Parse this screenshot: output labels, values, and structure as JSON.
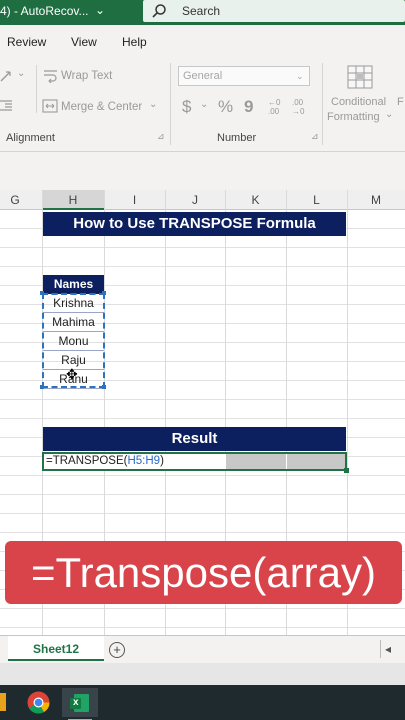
{
  "titlebar": {
    "title": "4) - AutoRecov...",
    "search_label": "Search",
    "chevron": "⌄",
    "color": "#1e6e42"
  },
  "menu": {
    "items": [
      "Review",
      "View",
      "Help"
    ]
  },
  "ribbon": {
    "wrap_text": "Wrap Text",
    "merge_center": "Merge & Center",
    "alignment_label": "Alignment",
    "number_format": "General",
    "currency_symbol": "$",
    "percent_symbol": "%",
    "comma_symbol": "9",
    "number_label": "Number",
    "conditional_formatting_line1": "Conditional",
    "conditional_formatting_line2": "Formatting",
    "cut_letter": "F",
    "dropdown_arrow": "⌄",
    "launcher_glyph": "⊿",
    "increase_decimal": "←0 .00",
    "decrease_decimal": ".00 →0"
  },
  "columns": [
    "G",
    "H",
    "I",
    "J",
    "K",
    "L",
    "M"
  ],
  "sheet": {
    "title": "How to Use TRANSPOSE Formula",
    "names_header": "Names",
    "names": [
      "Krishna",
      "Mahima",
      "Monu",
      "Raju",
      "Ranu"
    ],
    "result_header": "Result",
    "formula_prefix": "=TRANSPOSE(",
    "formula_range": "H5:H9",
    "formula_suffix": ")",
    "header_color": "#0c1f5e",
    "cursor": "✥"
  },
  "overlay": {
    "text": "=Transpose(array)",
    "color": "#d9444b"
  },
  "tabs": {
    "active": "Sheet12",
    "add_symbol": "+",
    "more_symbol": "◂"
  },
  "taskbar": {
    "apps": [
      "chrome-icon",
      "excel-icon"
    ],
    "excel_letter": "x"
  }
}
